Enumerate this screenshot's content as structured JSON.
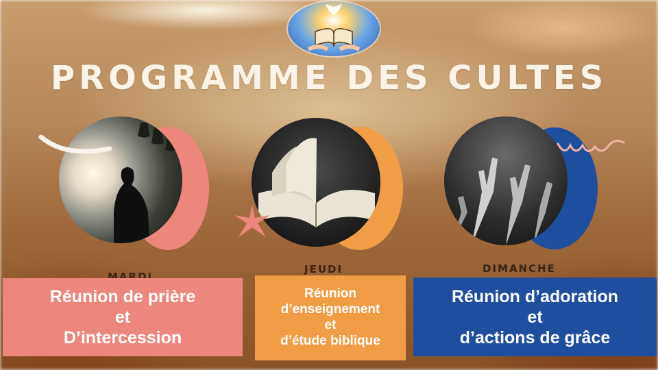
{
  "title": "PROGRAMME DES CULTES",
  "colors": {
    "pink": "#ee877b",
    "orange": "#f09d46",
    "blue": "#1d4f9e",
    "title": "#fbf3e6"
  },
  "services": [
    {
      "day": "MARDI",
      "lines": [
        "Réunion  de prière",
        "et",
        "D’intercession"
      ]
    },
    {
      "day": "JEUDI",
      "lines": [
        "Réunion",
        "d’enseignement",
        "et",
        "d’étude biblique"
      ]
    },
    {
      "day": "DIMANCHE",
      "lines": [
        "Réunion d’adoration",
        "et",
        "d’actions de grâce"
      ]
    }
  ]
}
